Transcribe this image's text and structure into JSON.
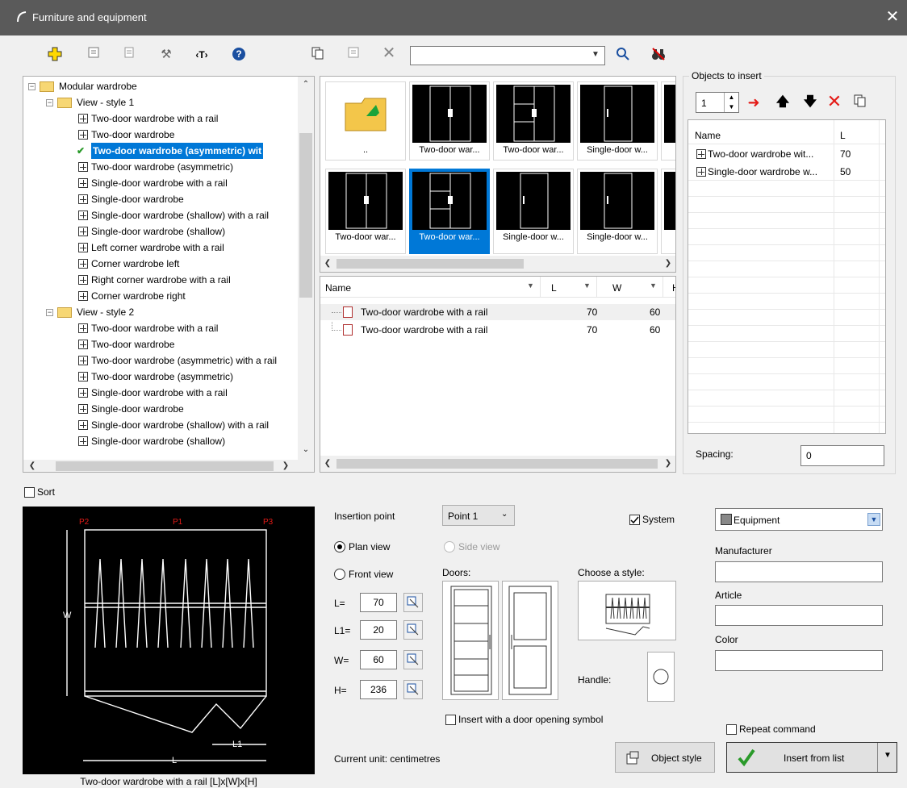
{
  "window": {
    "title": "Furniture and equipment",
    "close": "✕"
  },
  "toolbar": {
    "search_value": ""
  },
  "tree": {
    "items": [
      {
        "label": "Modular wardrobe",
        "level": 0,
        "kind": "folder"
      },
      {
        "label": "View - style 1",
        "level": 1,
        "kind": "folder"
      },
      {
        "label": "Two-door wardrobe with a rail",
        "level": 2,
        "kind": "item"
      },
      {
        "label": "Two-door wardrobe",
        "level": 2,
        "kind": "item"
      },
      {
        "label": "Two-door wardrobe (asymmetric) wit",
        "level": 2,
        "kind": "selected"
      },
      {
        "label": "Two-door wardrobe (asymmetric)",
        "level": 2,
        "kind": "item"
      },
      {
        "label": "Single-door wardrobe with a rail",
        "level": 2,
        "kind": "item"
      },
      {
        "label": "Single-door wardrobe",
        "level": 2,
        "kind": "item"
      },
      {
        "label": "Single-door wardrobe (shallow) with a rail",
        "level": 2,
        "kind": "item"
      },
      {
        "label": "Single-door wardrobe (shallow)",
        "level": 2,
        "kind": "item"
      },
      {
        "label": "Left corner wardrobe with a rail",
        "level": 2,
        "kind": "item"
      },
      {
        "label": "Corner wardrobe left",
        "level": 2,
        "kind": "item"
      },
      {
        "label": "Right corner wardrobe with a rail",
        "level": 2,
        "kind": "item"
      },
      {
        "label": "Corner wardrobe right",
        "level": 2,
        "kind": "item"
      },
      {
        "label": "View - style 2",
        "level": 1,
        "kind": "folder"
      },
      {
        "label": "Two-door wardrobe with a rail",
        "level": 2,
        "kind": "item"
      },
      {
        "label": "Two-door wardrobe",
        "level": 2,
        "kind": "item"
      },
      {
        "label": "Two-door wardrobe (asymmetric) with a rail",
        "level": 2,
        "kind": "item"
      },
      {
        "label": "Two-door wardrobe (asymmetric)",
        "level": 2,
        "kind": "item"
      },
      {
        "label": "Single-door wardrobe with a rail",
        "level": 2,
        "kind": "item"
      },
      {
        "label": "Single-door wardrobe",
        "level": 2,
        "kind": "item"
      },
      {
        "label": "Single-door wardrobe (shallow) with a rail",
        "level": 2,
        "kind": "item"
      },
      {
        "label": "Single-door wardrobe (shallow)",
        "level": 2,
        "kind": "item"
      }
    ]
  },
  "gallery": {
    "row1": [
      "..",
      "Two-door war...",
      "Two-door war...",
      "Single-door w...",
      "S"
    ],
    "row2": [
      "Two-door war...",
      "Two-door war...",
      "Single-door w...",
      "Single-door w...",
      "L"
    ]
  },
  "list": {
    "headers": [
      "Name",
      "L",
      "W",
      "H"
    ],
    "rows": [
      {
        "name": "Two-door wardrobe with a rail",
        "l": "70",
        "w": "60"
      },
      {
        "name": "Two-door wardrobe with a rail",
        "l": "70",
        "w": "60"
      }
    ]
  },
  "objects": {
    "group_label": "Objects to insert",
    "count": "1",
    "headers": [
      "Name",
      "L"
    ],
    "rows": [
      {
        "name": "Two-door wardrobe wit...",
        "l": "70"
      },
      {
        "name": "Single-door wardrobe w...",
        "l": "50"
      }
    ],
    "spacing_label": "Spacing:",
    "spacing_value": "0"
  },
  "sort_label": "Sort",
  "preview": {
    "caption": "Two-door wardrobe with a rail [L]x[W]x[H]",
    "p1": "P1",
    "p2": "P2",
    "p3": "P3",
    "w": "W",
    "l": "L",
    "l1": "L1"
  },
  "props": {
    "insertion_point_label": "Insertion point",
    "insertion_point_value": "Point 1",
    "plan_view": "Plan view",
    "side_view": "Side view",
    "front_view": "Front view",
    "doors_label": "Doors:",
    "choose_style_label": "Choose a style:",
    "handle_label": "Handle:",
    "l_label": "L=",
    "l_value": "70",
    "l1_label": "L1=",
    "l1_value": "20",
    "w_label": "W=",
    "w_value": "60",
    "h_label": "H=",
    "h_value": "236",
    "door_symbol": "Insert with a door opening symbol",
    "current_unit": "Current unit: centimetres",
    "system_label": "System",
    "layer_value": "Equipment",
    "manufacturer_label": "Manufacturer",
    "article_label": "Article",
    "color_label": "Color",
    "repeat_label": "Repeat command",
    "object_style": "Object style",
    "insert_from_list": "Insert from list"
  }
}
